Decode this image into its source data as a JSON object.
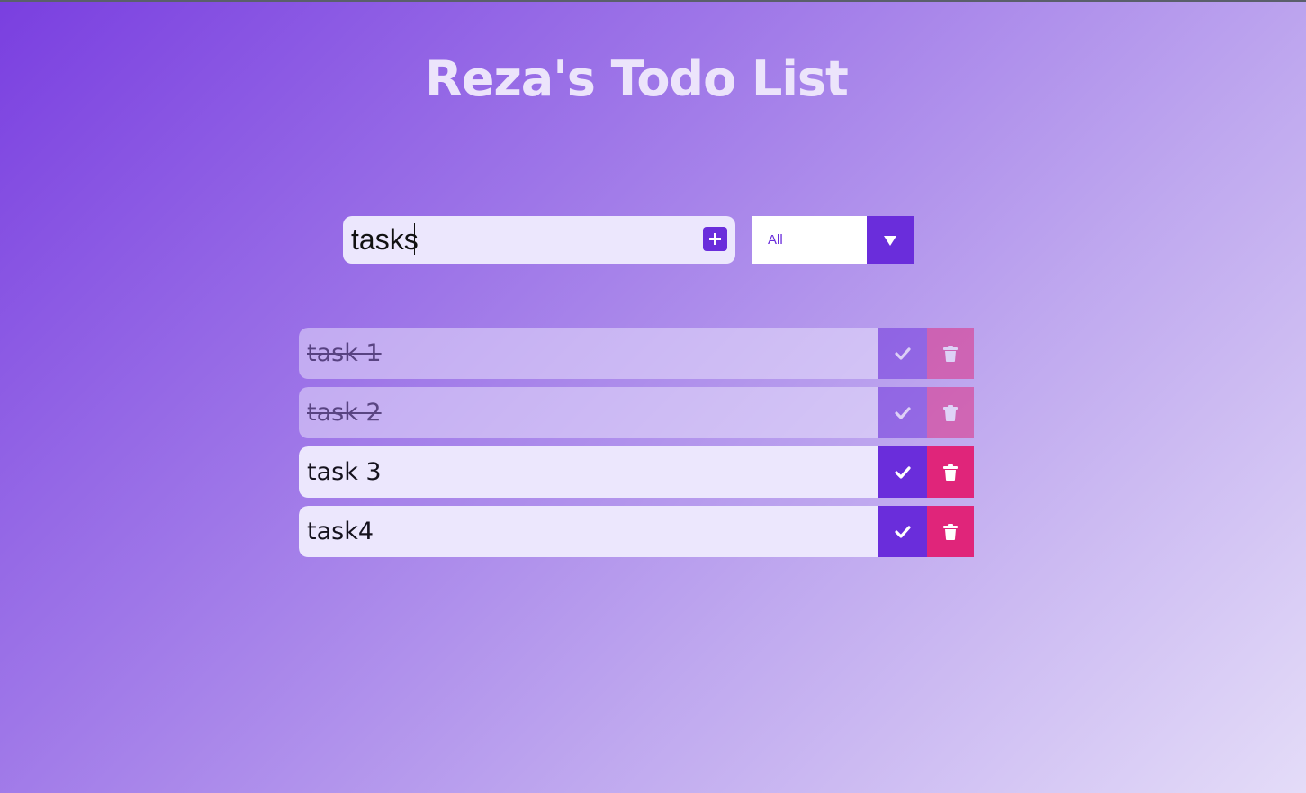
{
  "title": "Reza's Todo List",
  "form": {
    "input_value": "tasks",
    "add_icon": "plus-square-icon"
  },
  "filter": {
    "selected": "All",
    "arrow_icon": "caret-down-icon"
  },
  "todos": [
    {
      "text": "task 1",
      "completed": true
    },
    {
      "text": "task 2",
      "completed": true
    },
    {
      "text": "task 3",
      "completed": false
    },
    {
      "text": "task4",
      "completed": false
    }
  ],
  "colors": {
    "accent": "#6a2ddb",
    "delete": "#e0257a",
    "item_bg": "#ece7fd",
    "title": "#ece4fb"
  }
}
